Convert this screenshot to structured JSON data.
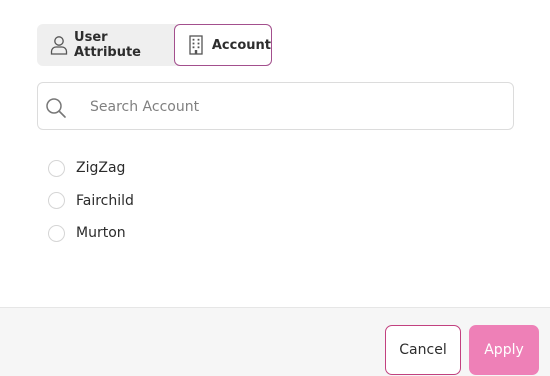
{
  "tabs": {
    "user_attribute": {
      "label": "User Attribute",
      "icon": "user-icon"
    },
    "account": {
      "label": "Account",
      "icon": "building-icon",
      "selected": true
    }
  },
  "search": {
    "placeholder": "Search Account",
    "value": "",
    "icon": "search-icon"
  },
  "accounts": [
    {
      "label": "ZigZag",
      "selected": false
    },
    {
      "label": "Fairchild",
      "selected": false
    },
    {
      "label": "Murton",
      "selected": false
    }
  ],
  "footer": {
    "cancel_label": "Cancel",
    "apply_label": "Apply"
  },
  "colors": {
    "accent": "#a34f8d",
    "apply_bg": "#ee80b7",
    "cancel_border": "#c2417f"
  }
}
